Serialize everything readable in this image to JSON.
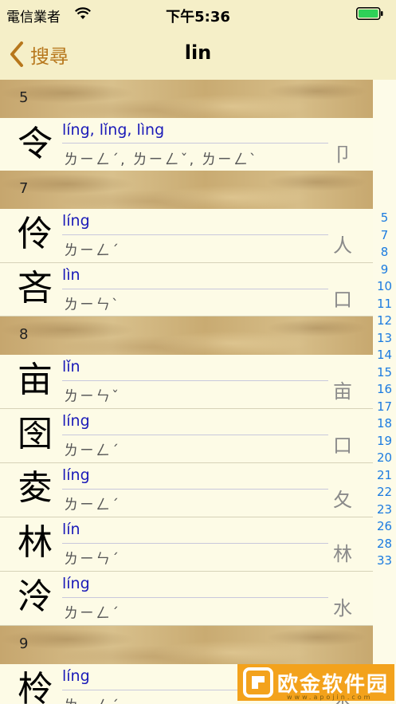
{
  "status": {
    "carrier": "電信業者",
    "time": "下午5:36"
  },
  "nav": {
    "back_label": "搜尋",
    "title": "lin"
  },
  "sections": [
    {
      "label": "5",
      "rows": [
        {
          "char": "令",
          "pinyin": "líng, lǐng, lìng",
          "zhuyin": "ㄌㄧㄥˊ, ㄌㄧㄥˇ, ㄌㄧㄥˋ",
          "radical": "卩"
        }
      ]
    },
    {
      "label": "7",
      "rows": [
        {
          "char": "伶",
          "pinyin": "líng",
          "zhuyin": "ㄌㄧㄥˊ",
          "radical": "人"
        },
        {
          "char": "吝",
          "pinyin": "lìn",
          "zhuyin": "ㄌㄧㄣˋ",
          "radical": "口"
        }
      ]
    },
    {
      "label": "8",
      "rows": [
        {
          "char": "亩",
          "pinyin": "lǐn",
          "zhuyin": "ㄌㄧㄣˇ",
          "radical": "亩"
        },
        {
          "char": "囹",
          "pinyin": "líng",
          "zhuyin": "ㄌㄧㄥˊ",
          "radical": "口"
        },
        {
          "char": "夌",
          "pinyin": "líng",
          "zhuyin": "ㄌㄧㄥˊ",
          "radical": "夂"
        },
        {
          "char": "林",
          "pinyin": "lín",
          "zhuyin": "ㄌㄧㄣˊ",
          "radical": "林"
        },
        {
          "char": "泠",
          "pinyin": "líng",
          "zhuyin": "ㄌㄧㄥˊ",
          "radical": "水"
        }
      ]
    },
    {
      "label": "9",
      "rows": [
        {
          "char": "柃",
          "pinyin": "líng",
          "zhuyin": "ㄌㄧㄥˊ",
          "radical": "木"
        }
      ]
    }
  ],
  "index": [
    "5",
    "7",
    "8",
    "9",
    "10",
    "11",
    "12",
    "13",
    "14",
    "15",
    "16",
    "17",
    "18",
    "19",
    "20",
    "21",
    "22",
    "23",
    "26",
    "28",
    "33"
  ],
  "watermark": {
    "text": "欧金软件园",
    "url": "www.apojin.com"
  },
  "colors": {
    "accent": "#b7771c",
    "pinyin": "#1a1ab8",
    "index": "#1b7be0"
  }
}
